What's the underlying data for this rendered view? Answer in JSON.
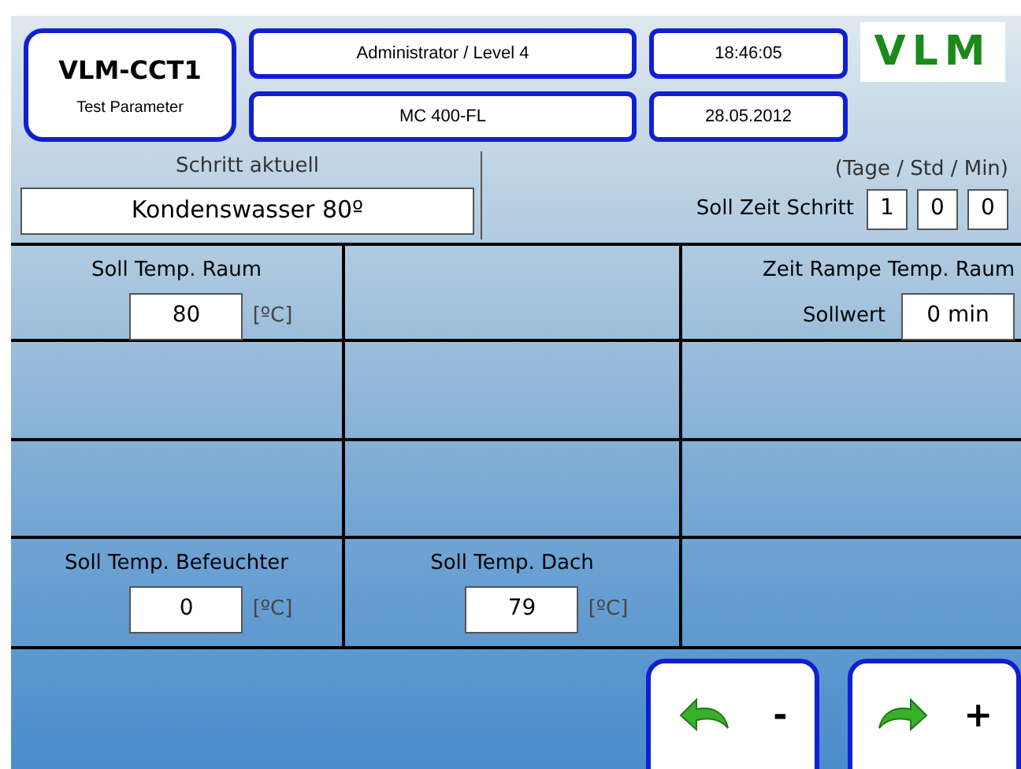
{
  "header": {
    "title": "VLM-CCT1",
    "subtitle": "Test Parameter",
    "user": "Administrator / Level 4",
    "device": "MC 400-FL",
    "time": "18:46:05",
    "date": "28.05.2012",
    "logo": "VLM"
  },
  "step": {
    "label": "Schritt aktuell",
    "value": "Kondenswasser 80º"
  },
  "step_time": {
    "units": "(Tage / Std / Min)",
    "label": "Soll Zeit Schritt",
    "values": [
      "1",
      "0",
      "0"
    ]
  },
  "cells": [
    {
      "kind": "setpoint",
      "label": "Soll Temp. Raum",
      "value": "80",
      "unit": "[ºC]"
    },
    {
      "kind": "empty"
    },
    {
      "kind": "ramp",
      "label": "Zeit Rampe Temp. Raum",
      "sublabel": "Sollwert",
      "value": "0 min"
    },
    {
      "kind": "empty"
    },
    {
      "kind": "empty"
    },
    {
      "kind": "empty"
    },
    {
      "kind": "empty"
    },
    {
      "kind": "empty"
    },
    {
      "kind": "empty"
    },
    {
      "kind": "setpoint",
      "label": "Soll Temp. Befeuchter",
      "value": "0",
      "unit": "[ºC]"
    },
    {
      "kind": "setpoint",
      "label": "Soll Temp. Dach",
      "value": "79",
      "unit": "[ºC]"
    },
    {
      "kind": "empty"
    }
  ],
  "buttons": [
    {
      "kind": "back",
      "label": "-"
    },
    {
      "kind": "forward",
      "label": "+"
    }
  ]
}
